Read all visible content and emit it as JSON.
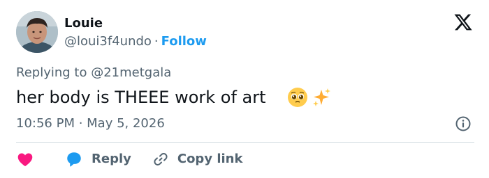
{
  "author": {
    "name": "Louie",
    "handle": "@loui3f4undo",
    "separator": "·",
    "follow_label": "Follow"
  },
  "icons": {
    "brand": "x-logo-icon",
    "like": "heart-icon",
    "reply": "reply-bubble-icon",
    "copy": "link-icon",
    "info": "info-icon",
    "emoji_1": "pleading-face-emoji",
    "emoji_2": "sparkles-emoji"
  },
  "reply_context": {
    "prefix": "Replying to",
    "mention": "@21metgala"
  },
  "tweet": {
    "text": "her body is THEEE work of art",
    "timestamp": "10:56 PM · May 5, 2026"
  },
  "actions": {
    "reply_label": "Reply",
    "copy_link_label": "Copy link"
  },
  "colors": {
    "accent": "#1d9bf0",
    "like": "#f91880",
    "secondary_text": "#536471",
    "primary_text": "#0f1419",
    "divider": "#cfd9de"
  }
}
